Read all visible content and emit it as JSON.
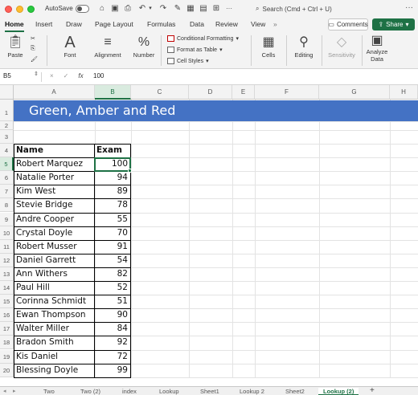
{
  "titlebar": {
    "autosave_label": "AutoSave",
    "search_placeholder": "Search (Cmd + Ctrl + U)"
  },
  "ribbon_tabs": [
    "Home",
    "Insert",
    "Draw",
    "Page Layout",
    "Formulas",
    "Data",
    "Review",
    "View"
  ],
  "ribbon_more": "»",
  "buttons": {
    "comments": "Comments",
    "share": "Share"
  },
  "ribbon": {
    "paste": "Paste",
    "font": "Font",
    "alignment": "Alignment",
    "number": "Number",
    "conditional_formatting": "Conditional Formatting",
    "format_as_table": "Format as Table",
    "cell_styles": "Cell Styles",
    "cells": "Cells",
    "editing": "Editing",
    "sensitivity": "Sensitivity",
    "analyze_data_1": "Analyze",
    "analyze_data_2": "Data"
  },
  "formula_bar": {
    "name_box": "B5",
    "cancel": "×",
    "enter": "✓",
    "fx": "fx",
    "value": "100"
  },
  "columns": [
    "A",
    "B",
    "C",
    "D",
    "E",
    "F",
    "G",
    "H"
  ],
  "selected_column": "B",
  "rows": [
    "1",
    "2",
    "3",
    "4",
    "5",
    "6",
    "7",
    "8",
    "9",
    "10",
    "11",
    "12",
    "13",
    "14",
    "15",
    "16",
    "17",
    "18",
    "19",
    "20"
  ],
  "selected_row": "5",
  "sheet": {
    "title": "Green, Amber and Red",
    "header_name": "Name",
    "header_exam": "Exam",
    "records": [
      {
        "name": "Robert Marquez",
        "exam": "100"
      },
      {
        "name": "Natalie Porter",
        "exam": "94"
      },
      {
        "name": "Kim West",
        "exam": "89"
      },
      {
        "name": "Stevie Bridge",
        "exam": "78"
      },
      {
        "name": "Andre Cooper",
        "exam": "55"
      },
      {
        "name": "Crystal Doyle",
        "exam": "70"
      },
      {
        "name": "Robert Musser",
        "exam": "91"
      },
      {
        "name": "Daniel Garrett",
        "exam": "54"
      },
      {
        "name": "Ann Withers",
        "exam": "82"
      },
      {
        "name": "Paul Hill",
        "exam": "52"
      },
      {
        "name": "Corinna Schmidt",
        "exam": "51"
      },
      {
        "name": "Ewan Thompson",
        "exam": "90"
      },
      {
        "name": "Walter Miller",
        "exam": "84"
      },
      {
        "name": "Bradon Smith",
        "exam": "92"
      },
      {
        "name": "Kis Daniel",
        "exam": "72"
      },
      {
        "name": "Blessing Doyle",
        "exam": "99"
      }
    ]
  },
  "sheet_tabs": [
    "Two",
    "Two (2)",
    "index",
    "Lookup",
    "Sheet1",
    "Lookup 2",
    "Sheet2",
    "Lookup (2)"
  ],
  "active_sheet": "Lookup (2)",
  "add_sheet": "+",
  "colors": {
    "accent": "#1e7145",
    "banner": "#4472c4"
  }
}
